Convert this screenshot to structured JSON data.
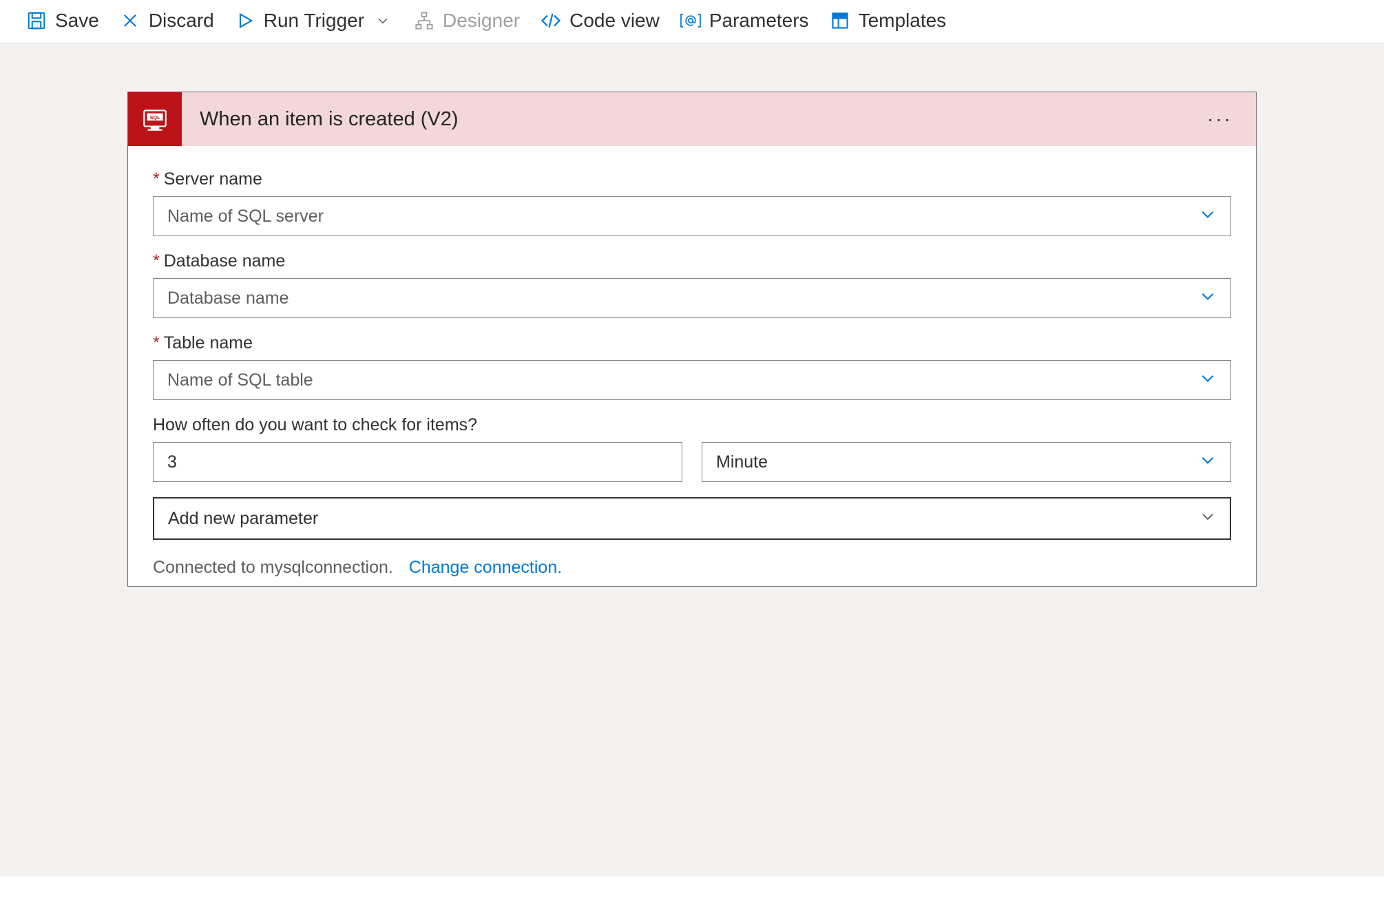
{
  "toolbar": {
    "save": "Save",
    "discard": "Discard",
    "runTrigger": "Run Trigger",
    "designer": "Designer",
    "codeView": "Code view",
    "parameters": "Parameters",
    "templates": "Templates"
  },
  "card": {
    "title": "When an item is created (V2)"
  },
  "fields": {
    "serverName": {
      "label": "Server name",
      "placeholder": "Name of SQL server"
    },
    "databaseName": {
      "label": "Database name",
      "placeholder": "Database name"
    },
    "tableName": {
      "label": "Table name",
      "placeholder": "Name of SQL table"
    },
    "frequencyLabel": "How often do you want to check for items?",
    "intervalValue": "3",
    "unitValue": "Minute",
    "addParameter": "Add new parameter"
  },
  "connection": {
    "text": "Connected to mysqlconnection.",
    "link": "Change connection."
  },
  "colors": {
    "accent": "#0078d4",
    "brand": "#ba1419"
  }
}
